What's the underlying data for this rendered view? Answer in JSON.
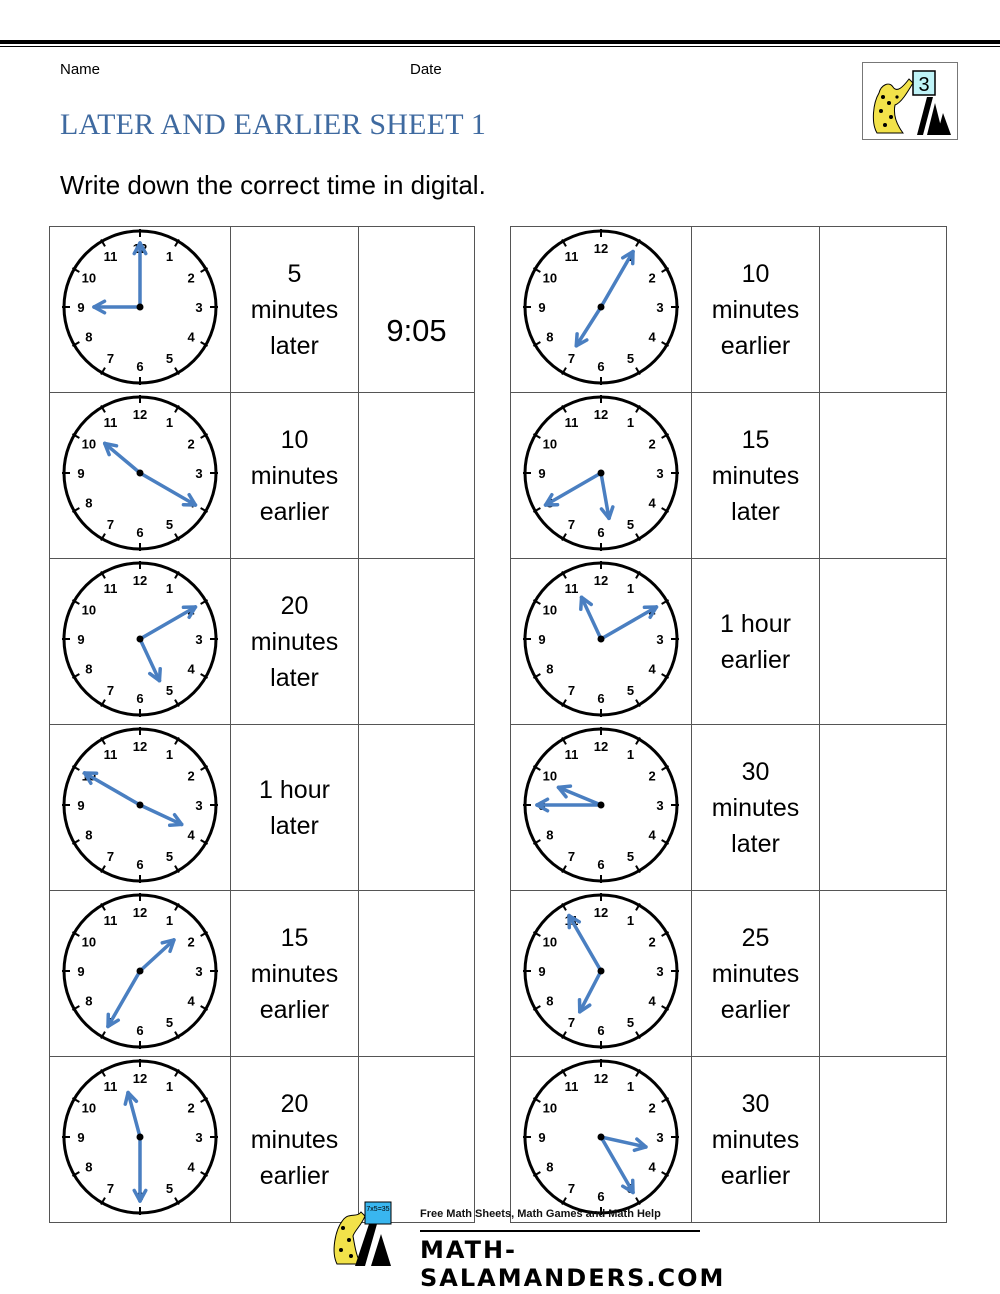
{
  "header": {
    "name_label": "Name",
    "date_label": "Date",
    "title": "LATER AND EARLIER SHEET 1",
    "instruction": "Write down the correct time in digital.",
    "logo_grade": "3"
  },
  "colors": {
    "title": "#3f6aa0",
    "hands": "#4a7fc1"
  },
  "left_column": [
    {
      "clock_time": "9:00",
      "hour": 9,
      "minute": 0,
      "offset_lines": [
        "5",
        "minutes",
        "later"
      ],
      "answer": "9:05"
    },
    {
      "clock_time": "10:20",
      "hour": 10,
      "minute": 20,
      "offset_lines": [
        "10",
        "minutes",
        "earlier"
      ],
      "answer": ""
    },
    {
      "clock_time": "5:10",
      "hour": 5,
      "minute": 10,
      "offset_lines": [
        "20",
        "minutes",
        "later"
      ],
      "answer": ""
    },
    {
      "clock_time": "3:50",
      "hour": 3,
      "minute": 50,
      "offset_lines": [
        "1 hour",
        "later"
      ],
      "answer": ""
    },
    {
      "clock_time": "1:35",
      "hour": 1,
      "minute": 35,
      "offset_lines": [
        "15",
        "minutes",
        "earlier"
      ],
      "answer": ""
    },
    {
      "clock_time": "11:30",
      "hour": 11,
      "minute": 30,
      "offset_lines": [
        "20",
        "minutes",
        "earlier"
      ],
      "answer": ""
    }
  ],
  "right_column": [
    {
      "clock_time": "7:05",
      "hour": 7,
      "minute": 5,
      "offset_lines": [
        "10",
        "minutes",
        "earlier"
      ],
      "answer": ""
    },
    {
      "clock_time": "5:40",
      "hour": 5,
      "minute": 40,
      "offset_lines": [
        "15",
        "minutes",
        "later"
      ],
      "answer": ""
    },
    {
      "clock_time": "11:10",
      "hour": 11,
      "minute": 10,
      "offset_lines": [
        "1 hour",
        "earlier"
      ],
      "answer": ""
    },
    {
      "clock_time": "9:45",
      "hour": 9,
      "minute": 45,
      "offset_lines": [
        "30",
        "minutes",
        "later"
      ],
      "answer": ""
    },
    {
      "clock_time": "6:55",
      "hour": 6,
      "minute": 55,
      "offset_lines": [
        "25",
        "minutes",
        "earlier"
      ],
      "answer": ""
    },
    {
      "clock_time": "3:25",
      "hour": 3,
      "minute": 25,
      "offset_lines": [
        "30",
        "minutes",
        "earlier"
      ],
      "answer": ""
    }
  ],
  "footer": {
    "tagline": "Free Math Sheets, Math Games and Math Help",
    "site": "MATH-SALAMANDERS.COM",
    "board_text": "7x5=35"
  }
}
